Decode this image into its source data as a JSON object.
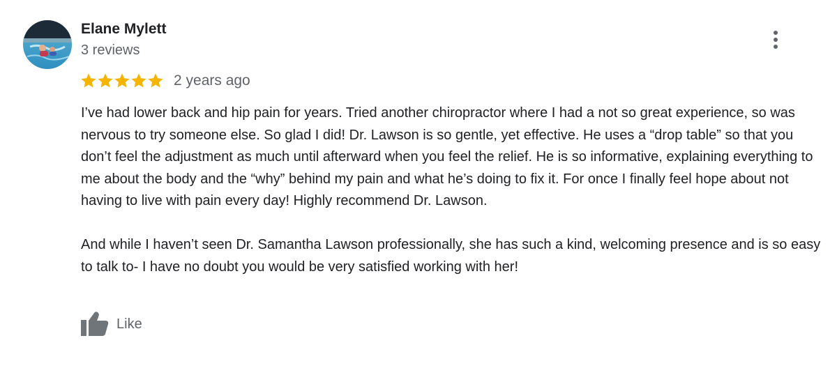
{
  "review": {
    "author_name": "Elane Mylett",
    "review_count": "3 reviews",
    "rating": 5,
    "rating_max": 5,
    "date": "2 years ago",
    "paragraphs": [
      "I’ve had lower back and hip pain for years. Tried another chiropractor where I had a not so great experience, so was nervous to try someone else. So glad I did! Dr. Lawson is so gentle, yet effective. He uses a “drop table” so that you don’t feel the adjustment as much until afterward when you feel the relief. He is so informative, explaining everything to me about the body and the “why” behind my pain and what he’s doing to fix it. For once I finally feel hope about not having to live with pain every day! Highly recommend Dr. Lawson.",
      "And while I haven’t seen Dr. Samantha Lawson professionally, she has such a kind, welcoming presence and is so easy to talk to- I have no doubt you would be very satisfied working with her!"
    ],
    "like_label": "Like"
  },
  "icons": {
    "star": "star-icon",
    "more": "more-vertical-icon",
    "like": "thumbs-up-icon"
  },
  "colors": {
    "star": "#f4b400",
    "name": "#202124",
    "secondary_text": "#5f6368",
    "like_icon": "#70757a"
  }
}
